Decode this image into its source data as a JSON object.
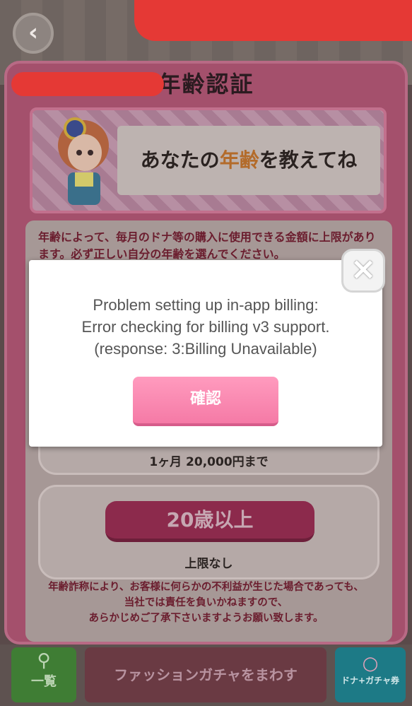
{
  "background": {
    "back_icon": "chevron-left-icon",
    "back_glyph": "‹"
  },
  "dialog": {
    "title": "年齢認証",
    "banner": {
      "pre": "あなたの",
      "highlight": "年齢",
      "post": "を教えてね"
    },
    "notice": "年齢によって、毎月のドナ等の購入に使用できる金額に上限があります。必ず正しい自分の年齢を選んでください。",
    "options": [
      {
        "label": "",
        "limit": ""
      },
      {
        "label": "",
        "limit": "1ヶ月 20,000円まで"
      },
      {
        "label": "20歳以上",
        "limit": "上限なし"
      }
    ],
    "footer_lines": [
      "年齢詐称により、お客様に何らかの不利益が生じた場合であっても、",
      "当社では責任を負いかねますので、",
      "あらかじめご了承下さいますようお願い致します。"
    ]
  },
  "bottom_bar": {
    "list_label": "一覧",
    "gacha_label": "ファッションガチャをまわす",
    "ticket_label": "ドナ+ガチャ券"
  },
  "alert": {
    "line1": "Problem setting up in-app billing:",
    "line2": "Error checking for billing v3 support.",
    "line3": "(response: 3:Billing Unavailable)",
    "ok_label": "確認",
    "close_glyph": "×"
  }
}
